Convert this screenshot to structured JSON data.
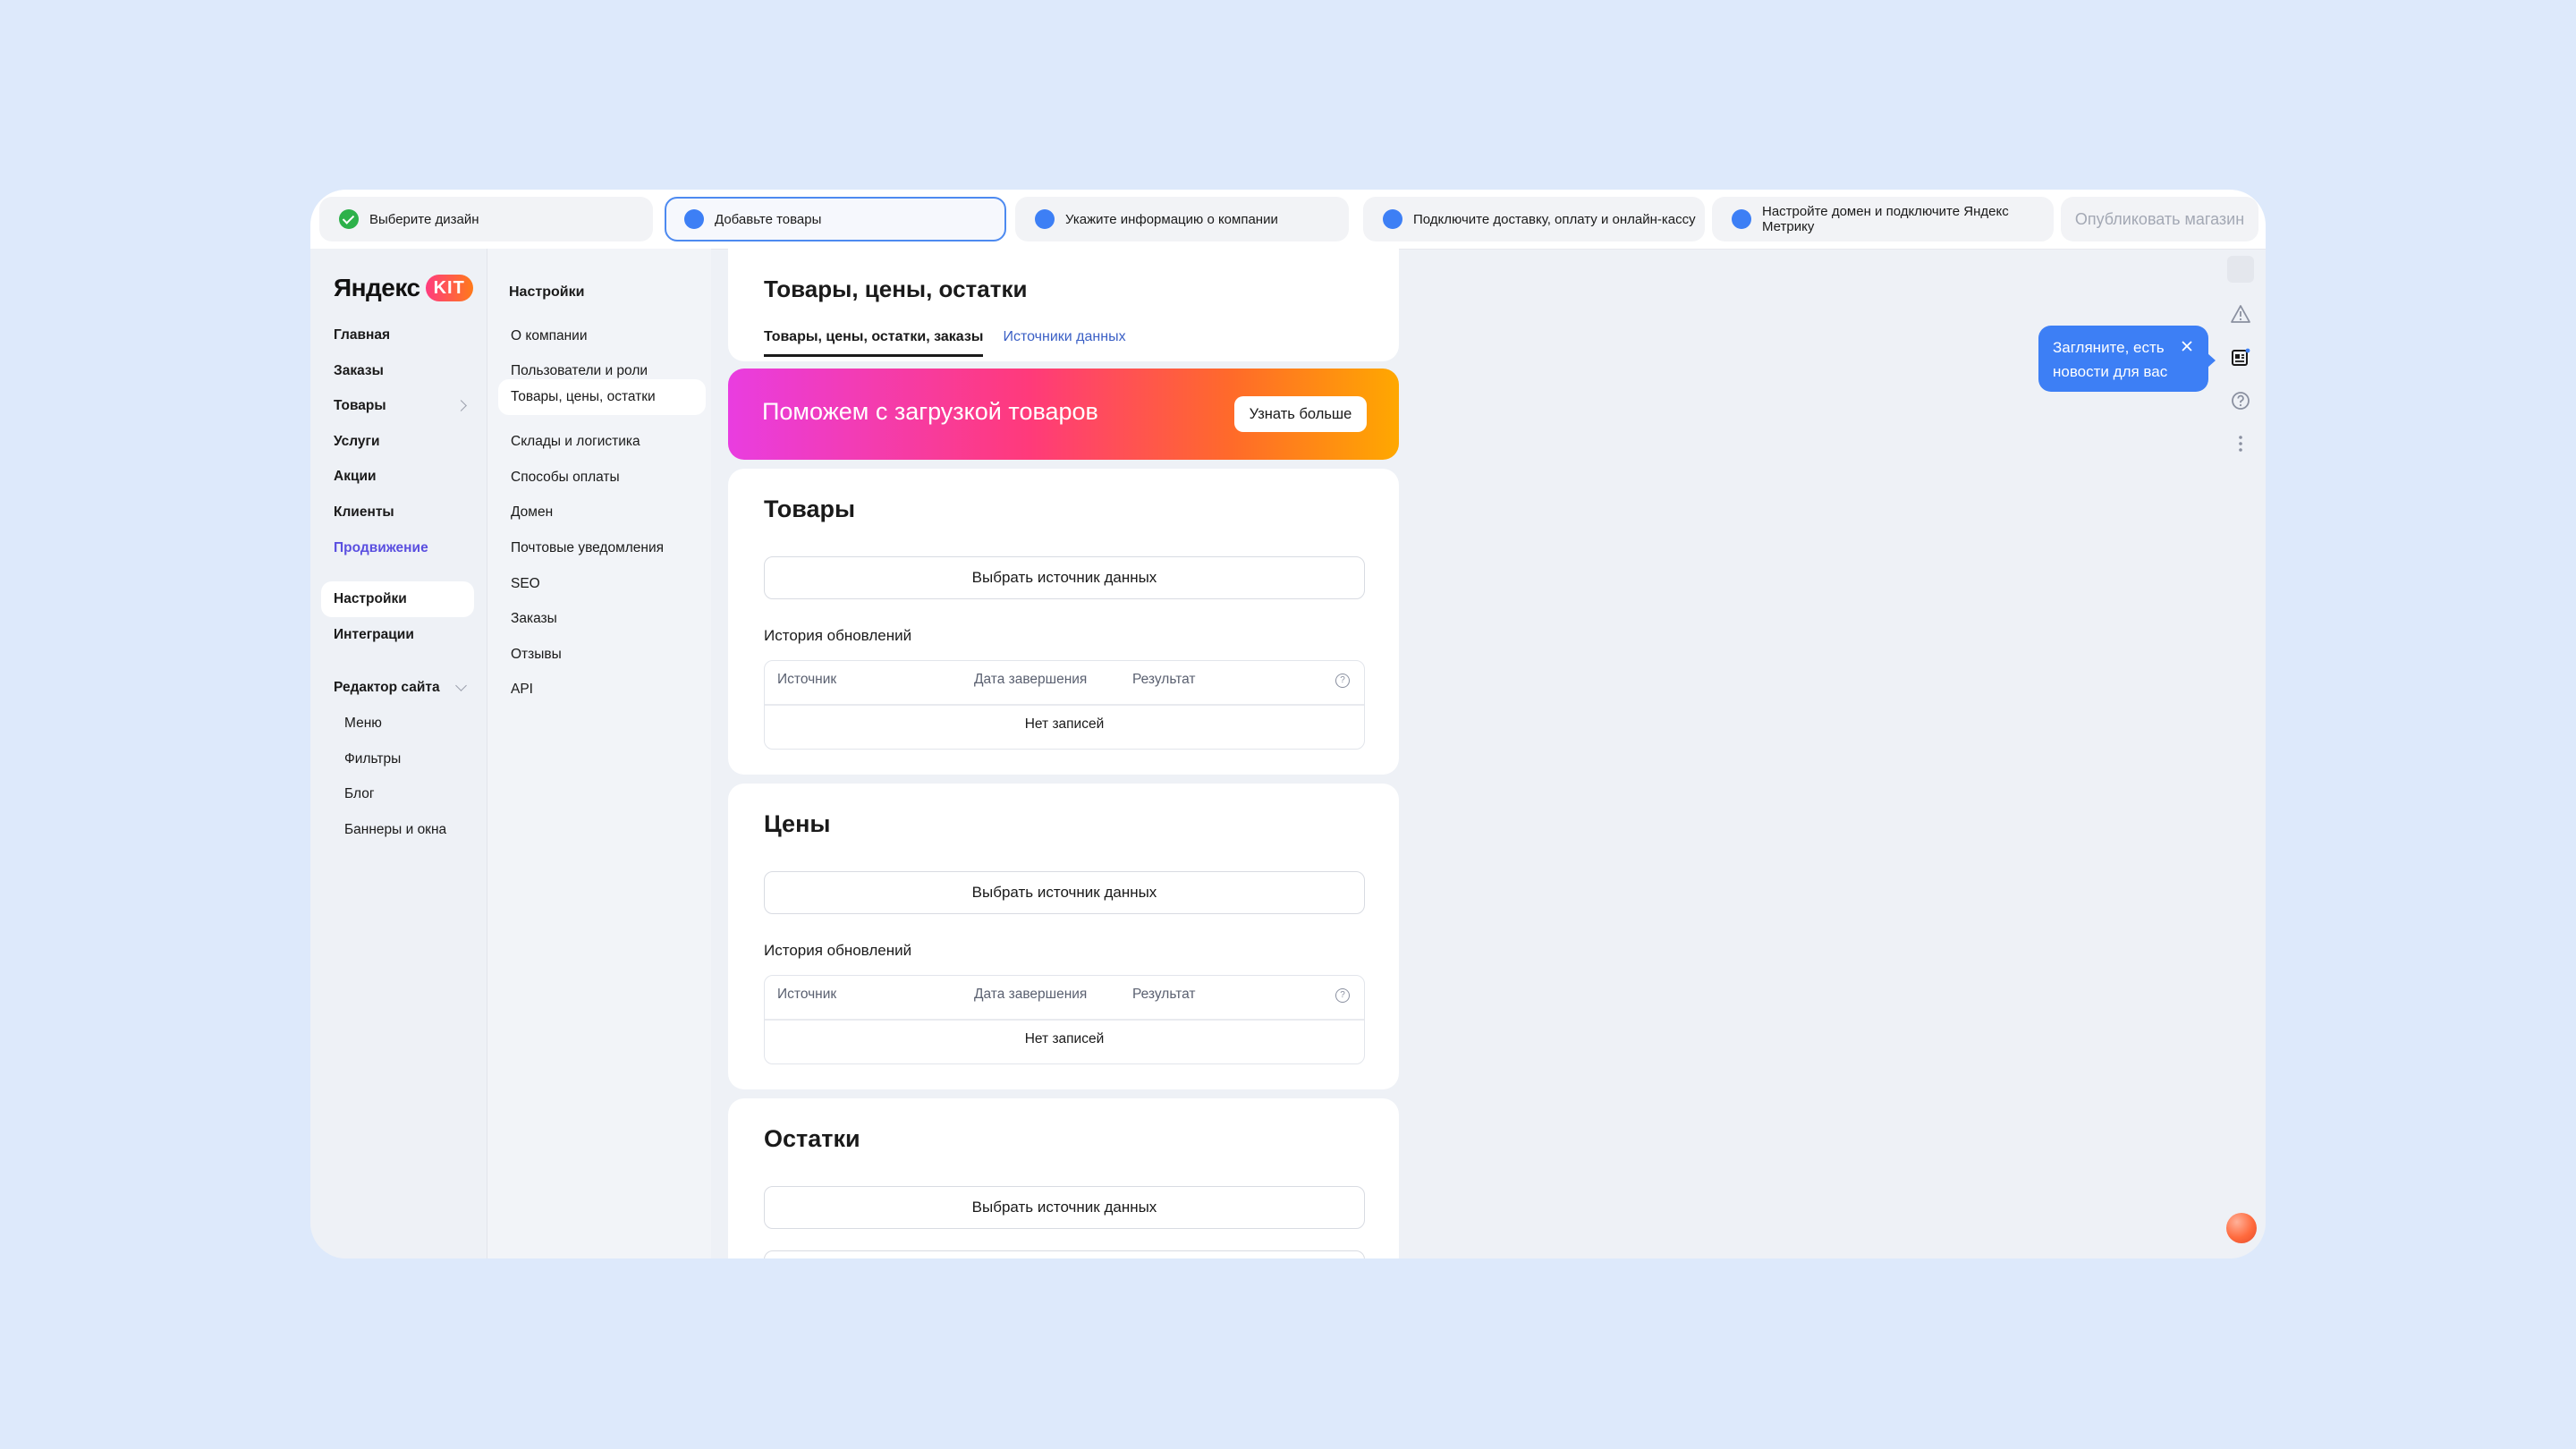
{
  "steps": [
    {
      "label": "Выберите дизайн",
      "status": "done"
    },
    {
      "label": "Добавьте товары",
      "status": "active"
    },
    {
      "label": "Укажите информацию о компании",
      "status": "todo"
    },
    {
      "label": "Подключите доставку, оплату и онлайн-кассу",
      "status": "todo"
    },
    {
      "label": "Настройте домен и подключите Яндекс Метрику",
      "status": "todo"
    }
  ],
  "publish_label": "Опубликовать магазин",
  "logo": {
    "word": "Яндекс",
    "badge": "KIT"
  },
  "nav": {
    "items": [
      "Главная",
      "Заказы",
      "Товары",
      "Услуги",
      "Акции",
      "Клиенты",
      "Продвижение",
      "Настройки",
      "Интеграции",
      "Редактор сайта"
    ],
    "sub_items": [
      "Меню",
      "Фильтры",
      "Блог",
      "Баннеры и окна"
    ]
  },
  "settings_menu": {
    "title": "Настройки",
    "items": [
      "О компании",
      "Пользователи и роли",
      "Товары, цены, остатки",
      "Склады и логистика",
      "Способы оплаты",
      "Домен",
      "Почтовые уведомления",
      "SEO",
      "Заказы",
      "Отзывы",
      "API"
    ]
  },
  "page": {
    "title": "Товары, цены, остатки",
    "tabs": [
      "Товары, цены, остатки, заказы",
      "Источники данных"
    ]
  },
  "promo": {
    "text": "Поможем с загрузкой товаров",
    "button": "Узнать больше"
  },
  "sections": [
    {
      "title": "Товары",
      "button": "Выбрать источник данных",
      "history": "История обновлений",
      "cols": [
        "Источник",
        "Дата завершения",
        "Результат"
      ],
      "empty": "Нет записей"
    },
    {
      "title": "Цены",
      "button": "Выбрать источник данных",
      "history": "История обновлений",
      "cols": [
        "Источник",
        "Дата завершения",
        "Результат"
      ],
      "empty": "Нет записей"
    },
    {
      "title": "Остатки",
      "button": "Выбрать источник данных"
    }
  ],
  "tooltip": {
    "text_line1": "Загляните, есть",
    "text_line2": "новости для вас"
  },
  "colors": {
    "accent": "#3d7ff5",
    "done": "#2db14a",
    "link": "#5a4fe0"
  }
}
